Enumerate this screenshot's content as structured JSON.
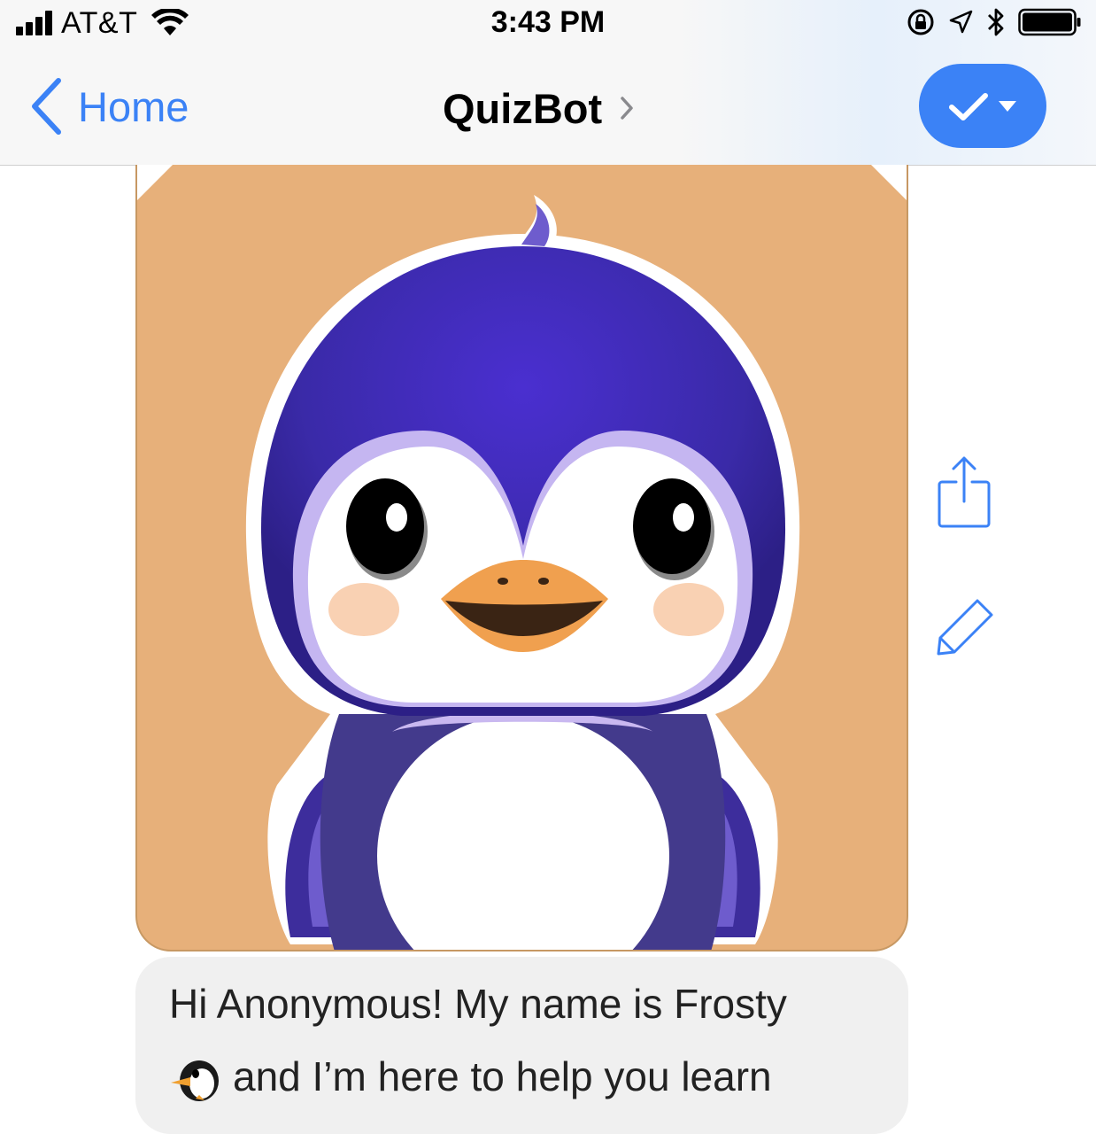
{
  "status_bar": {
    "carrier": "AT&T",
    "time": "3:43 PM",
    "icons": [
      "signal-bars",
      "wifi",
      "orientation-lock",
      "location-arrow",
      "bluetooth",
      "battery-full"
    ]
  },
  "nav": {
    "back_label": "Home",
    "title": "QuizBot",
    "title_chevron_icon": "chevron-right",
    "action_icons": [
      "checkmark",
      "caret-down"
    ]
  },
  "chat": {
    "image_alt": "Frosty the penguin",
    "side_actions": [
      "share-icon",
      "edit-pencil-icon"
    ],
    "message_line1": "Hi Anonymous! My name is Frosty",
    "message_line2": "and I’m here to help you learn"
  },
  "colors": {
    "accent": "#3b82f6",
    "card_background": "#e7b07a",
    "bubble_background": "#f0f0f0",
    "penguin_body": "#3f2fae"
  }
}
